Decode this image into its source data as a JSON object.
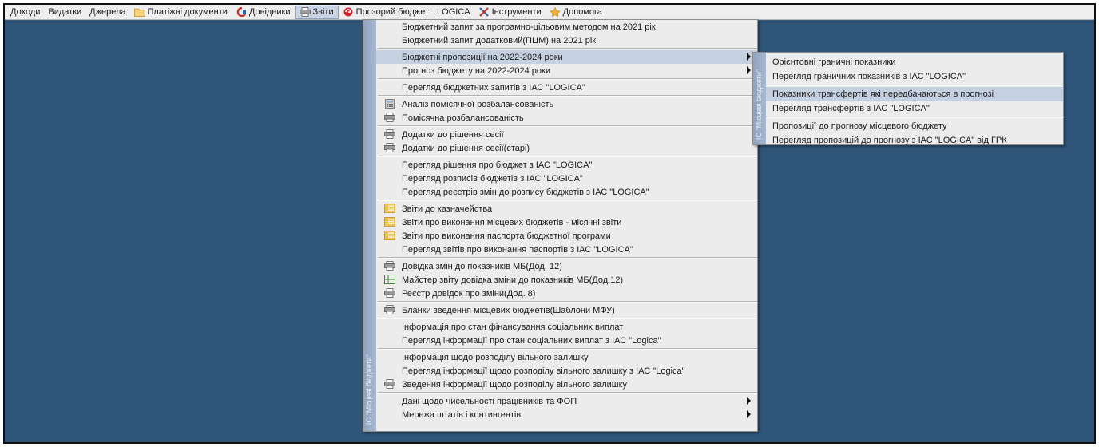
{
  "menubar": {
    "items": [
      {
        "label": "Доходи",
        "icon": ""
      },
      {
        "label": "Видатки",
        "icon": ""
      },
      {
        "label": "Джерела",
        "icon": ""
      },
      {
        "label": "Платіжні документи",
        "icon": "folder-icon"
      },
      {
        "label": "Довідники",
        "icon": "directory-icon"
      },
      {
        "label": "Звіти",
        "icon": "printer-icon",
        "active": true
      },
      {
        "label": "Прозорий бюджет",
        "icon": "transparent-budget-icon"
      },
      {
        "label": "LOGICA",
        "icon": ""
      },
      {
        "label": "Інструменти",
        "icon": "tools-icon"
      },
      {
        "label": "Допомога",
        "icon": "help-icon"
      }
    ]
  },
  "reports_menu": {
    "side_label": "ІС \"Місцеві бюджети\"",
    "groups": [
      [
        {
          "label": "Бюджетний запит за програмно-цільовим методом на 2021 рік",
          "icon": ""
        },
        {
          "label": "Бюджетний запит додатковий(ПЦМ) на 2021 рік",
          "icon": ""
        }
      ],
      [
        {
          "label": "Бюджетні пропозиції на 2022-2024 роки",
          "icon": "",
          "submenu": true,
          "highlighted": true
        },
        {
          "label": "Прогноз бюджету на 2022-2024 роки",
          "icon": "",
          "submenu": true
        }
      ],
      [
        {
          "label": "Перегляд бюджетних запитів з ІАС \"LOGICA\"",
          "icon": ""
        }
      ],
      [
        {
          "label": "Аналіз помісячної розбалансованість",
          "icon": "calculator-icon"
        },
        {
          "label": "Помісячна розбалансованість",
          "icon": "printer-icon"
        }
      ],
      [
        {
          "label": "Додатки до рішення сесії",
          "icon": "printer-icon"
        },
        {
          "label": "Додатки до рішення сесії(старі)",
          "icon": "printer-icon"
        }
      ],
      [
        {
          "label": "Перегляд рішення про бюджет з ІАС \"LOGICA\"",
          "icon": ""
        },
        {
          "label": "Перегляд розписів бюджетів з ІАС \"LOGICA\"",
          "icon": ""
        },
        {
          "label": "Перегляд реєстрів змін до розпису бюджетів з ІАС \"LOGICA\"",
          "icon": ""
        }
      ],
      [
        {
          "label": "Звіти до казначейства",
          "icon": "report-folder-icon"
        },
        {
          "label": "Звіти про виконання місцевих бюджетів - місячні звіти",
          "icon": "report-folder-icon"
        },
        {
          "label": "Звіти про виконання паспорта бюджетної програми",
          "icon": "report-folder-icon"
        },
        {
          "label": "Перегляд звітів про виконання паспортів з ІАС \"LOGICA\"",
          "icon": ""
        }
      ],
      [
        {
          "label": "Довідка змін до показників МБ(Дод. 12)",
          "icon": "printer-icon"
        },
        {
          "label": "Майстер звіту довідка зміни до показників МБ(Дод.12)",
          "icon": "grid-icon"
        },
        {
          "label": "Реєстр довідок про зміни(Дод. 8)",
          "icon": "printer-icon"
        }
      ],
      [
        {
          "label": "Бланки зведення місцевих бюджетів(Шаблони МФУ)",
          "icon": "printer-icon"
        }
      ],
      [
        {
          "label": "Інформація про стан фінансування соціальних виплат",
          "icon": ""
        },
        {
          "label": "Перегляд інформації про стан соціальних виплат з ІАС \"Logica\"",
          "icon": ""
        }
      ],
      [
        {
          "label": "Інформація щодо розподілу вільного залишку",
          "icon": ""
        },
        {
          "label": "Перегляд інформації щодо розподілу вільного залишку з ІАС \"Logica\"",
          "icon": ""
        },
        {
          "label": "Зведення інформації щодо розподілу вільного залишку",
          "icon": "printer-icon"
        }
      ],
      [
        {
          "label": "Дані щодо чисельності працівників та ФОП",
          "icon": "",
          "submenu": true
        },
        {
          "label": "Мережа штатів і контингентів",
          "icon": "",
          "submenu": true
        }
      ]
    ]
  },
  "submenu": {
    "side_label": "ІС \"Місцеві бюджети\"",
    "groups": [
      [
        {
          "label": "Орієнтовні граничні показники"
        },
        {
          "label": "Перегляд граничних показників з ІАС \"LOGICA\""
        }
      ],
      [
        {
          "label": "Показники трансфертів які передбачаються в прогнозі",
          "highlighted": true
        },
        {
          "label": "Перегляд трансфертів з ІАС \"LOGICA\""
        }
      ],
      [
        {
          "label": "Пропозиції до прогнозу місцевого бюджету"
        },
        {
          "label": "Перегляд пропозицій до прогнозу з ІАС \"LOGICA\" від ГРК"
        }
      ]
    ]
  },
  "colors": {
    "desktop": "#2f5578",
    "menu_bg": "#ececec",
    "highlight": "#c5d0e0"
  }
}
